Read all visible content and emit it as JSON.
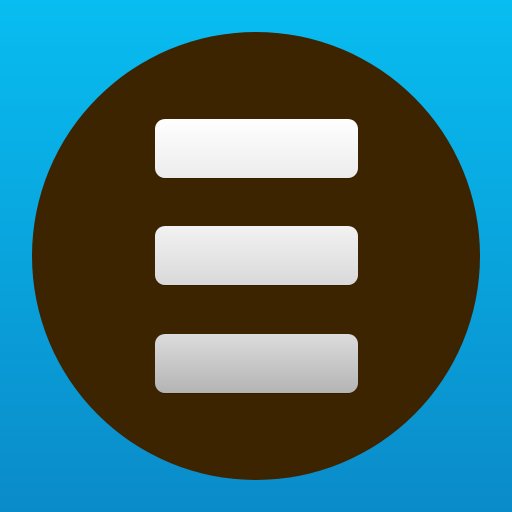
{
  "icon": {
    "name": "menu-icon",
    "colors": {
      "background_top": "#08bdf1",
      "background_bottom": "#0a8bc9",
      "circle": "#3d2400",
      "bar_top": "#ffffff",
      "bar_middle": "#e6e6e6",
      "bar_bottom": "#c4c4c4"
    },
    "bar_count": 3
  }
}
